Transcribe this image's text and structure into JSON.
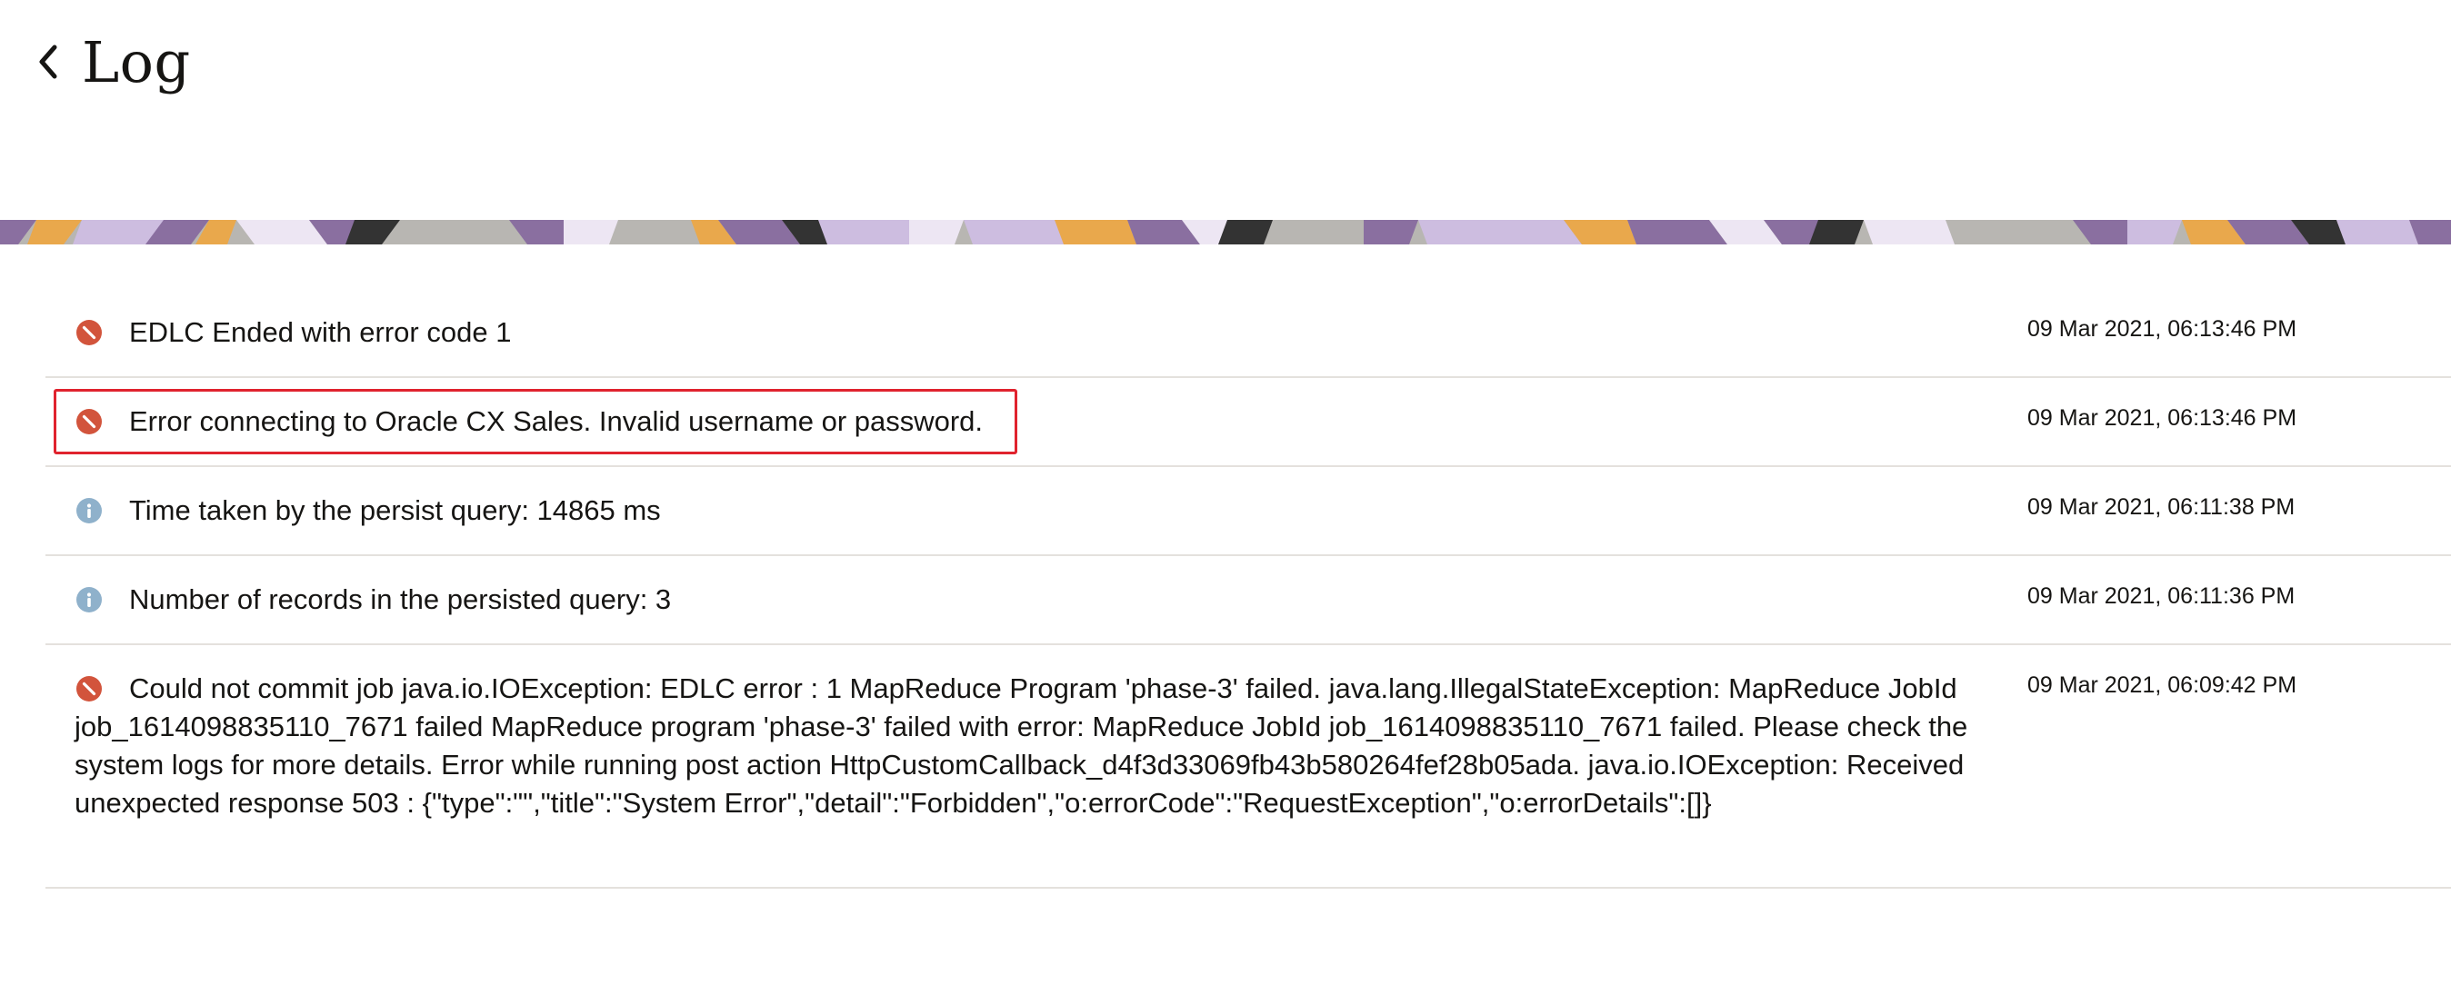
{
  "header": {
    "title": "Log",
    "back_icon": "chevron-left-icon"
  },
  "banner": {
    "colors": [
      "#8a6fa0",
      "#e9a84c",
      "#cdbde0",
      "#333333",
      "#b8b6b2",
      "#ede6f3"
    ]
  },
  "status_colors": {
    "error": "#d2543c",
    "info": "#8fb1cb"
  },
  "log_entries": [
    {
      "type": "error",
      "icon": "error-icon",
      "message": "EDLC Ended with error code 1",
      "timestamp": "09 Mar 2021, 06:13:46 PM"
    },
    {
      "type": "error",
      "icon": "error-icon",
      "message": "Error connecting to Oracle CX Sales. Invalid username or password.",
      "timestamp": "09 Mar 2021, 06:13:46 PM",
      "highlighted": true
    },
    {
      "type": "info",
      "icon": "info-icon",
      "message": "Time taken by the persist query: 14865 ms",
      "timestamp": "09 Mar 2021, 06:11:38 PM"
    },
    {
      "type": "info",
      "icon": "info-icon",
      "message": "Number of records in the persisted query: 3",
      "timestamp": "09 Mar 2021, 06:11:36 PM"
    },
    {
      "type": "error",
      "icon": "error-icon",
      "message": "Could not commit job java.io.IOException: EDLC error : 1 MapReduce Program 'phase-3' failed. java.lang.IllegalStateException: MapReduce JobId job_1614098835110_7671 failed MapReduce program 'phase-3' failed with error: MapReduce JobId job_1614098835110_7671 failed. Please check the system logs for more details. Error while running post action HttpCustomCallback_d4f3d33069fb43b580264fef28b05ada. java.io.IOException: Received unexpected response 503 : {\"type\":\"\",\"title\":\"System Error\",\"detail\":\"Forbidden\",\"o:errorCode\":\"RequestException\",\"o:errorDetails\":[]}",
      "timestamp": "09 Mar 2021, 06:09:42 PM"
    }
  ]
}
